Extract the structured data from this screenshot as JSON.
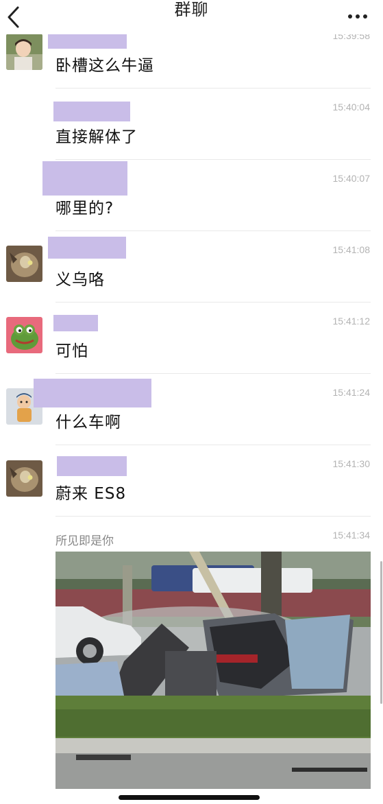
{
  "header": {
    "title": "群聊"
  },
  "messages": [
    {
      "time": "15:39:58",
      "text": "卧槽这么牛逼"
    },
    {
      "time": "15:40:04",
      "text": "直接解体了"
    },
    {
      "time": "15:40:07",
      "text": "哪里的?"
    },
    {
      "time": "15:41:08",
      "text": "义乌咯"
    },
    {
      "time": "15:41:12",
      "text": "可怕"
    },
    {
      "time": "15:41:24",
      "text": "什么车啊"
    },
    {
      "time": "15:41:30",
      "text": "蔚来 ES8"
    },
    {
      "time": "15:41:34",
      "sender": "所见即是你"
    }
  ],
  "icons": {
    "back": "chevron-left-icon",
    "more": "more-dots-icon"
  },
  "colors": {
    "name_redaction": "#c9bde8",
    "timestamp": "#b3b3b3",
    "divider": "#e9e9e9"
  }
}
